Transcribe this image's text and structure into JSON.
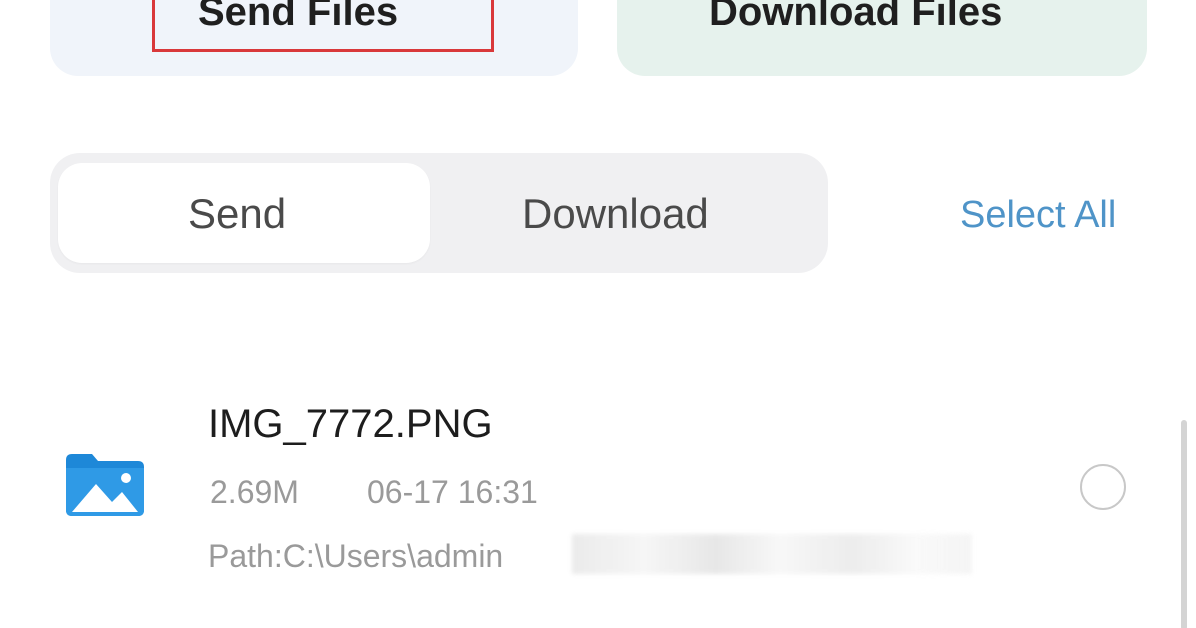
{
  "top_cards": {
    "send_label": "Send Files",
    "download_label": "Download Files"
  },
  "tabs": {
    "send_label": "Send",
    "download_label": "Download",
    "active": "Send"
  },
  "select_all_label": "Select All",
  "files": [
    {
      "name": "IMG_7772.PNG",
      "size": "2.69M",
      "date": "06-17 16:31",
      "path": "Path:C:\\Users\\admin",
      "icon": "image-folder-icon",
      "selected": false
    }
  ],
  "colors": {
    "accent_link": "#4f94c8",
    "highlight_border": "#d9383a",
    "send_card_bg": "#f0f4fa",
    "download_card_bg": "#e6f2ed"
  }
}
